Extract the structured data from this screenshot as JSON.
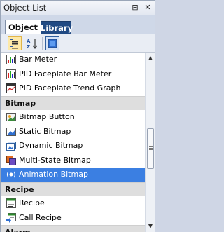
{
  "window": {
    "title": "Object List",
    "pin_glyph": "⊟",
    "close_glyph": "✕"
  },
  "tabs": [
    {
      "label": "Object",
      "active": true
    },
    {
      "label": "Library",
      "active": false
    }
  ],
  "toolbar": {
    "buttons": [
      {
        "name": "sort-by-category",
        "pressed": true
      },
      {
        "name": "sort-alphabetical",
        "pressed": false
      },
      {
        "name": "toggle-view",
        "pressed": false
      }
    ]
  },
  "list": {
    "items": [
      {
        "type": "item",
        "label": "Bar Meter",
        "icon": "bar-meter-icon"
      },
      {
        "type": "item",
        "label": "PID Faceplate Bar Meter",
        "icon": "pid-bar-icon"
      },
      {
        "type": "item",
        "label": "PID Faceplate Trend Graph",
        "icon": "pid-trend-icon"
      },
      {
        "type": "group",
        "label": "Bitmap"
      },
      {
        "type": "item",
        "label": "Bitmap Button",
        "icon": "bitmap-button-icon"
      },
      {
        "type": "item",
        "label": "Static Bitmap",
        "icon": "static-bitmap-icon"
      },
      {
        "type": "item",
        "label": "Dynamic Bitmap",
        "icon": "dynamic-bitmap-icon"
      },
      {
        "type": "item",
        "label": "Multi-State Bitmap",
        "icon": "multi-state-bitmap-icon"
      },
      {
        "type": "item",
        "label": "Animation Bitmap",
        "icon": "animation-bitmap-icon",
        "selected": true
      },
      {
        "type": "group",
        "label": "Recipe"
      },
      {
        "type": "item",
        "label": "Recipe",
        "icon": "recipe-icon"
      },
      {
        "type": "item",
        "label": "Call Recipe",
        "icon": "call-recipe-icon"
      },
      {
        "type": "group",
        "label": "Alarm"
      }
    ]
  },
  "colors": {
    "selection": "#3b7fe2",
    "group_header": "#dedede",
    "inactive_tab": "#214a83"
  }
}
